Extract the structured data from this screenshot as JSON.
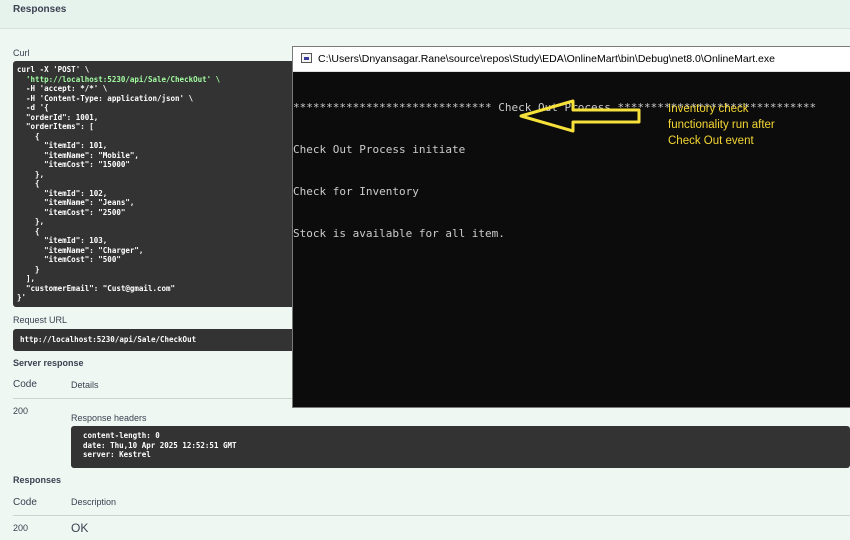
{
  "page": {
    "responses_title": "Responses",
    "curl_label": "Curl",
    "curl_lines": [
      [
        "curl -X 'POST' \\",
        ""
      ],
      [
        "  ",
        "'http://localhost:5230/api/Sale/CheckOut' \\"
      ],
      [
        "  -H 'accept: */*' \\",
        ""
      ],
      [
        "  -H 'Content-Type: application/json' \\",
        ""
      ],
      [
        "  -d '{",
        ""
      ],
      [
        "  \"orderId\": 1001,",
        ""
      ],
      [
        "  \"orderItems\": [",
        ""
      ],
      [
        "    {",
        ""
      ],
      [
        "      \"itemId\": 101,",
        ""
      ],
      [
        "      \"itemName\": \"Mobile\",",
        ""
      ],
      [
        "      \"itemCost\": \"15000\"",
        ""
      ],
      [
        "    },",
        ""
      ],
      [
        "    {",
        ""
      ],
      [
        "      \"itemId\": 102,",
        ""
      ],
      [
        "      \"itemName\": \"Jeans\",",
        ""
      ],
      [
        "      \"itemCost\": \"2500\"",
        ""
      ],
      [
        "    },",
        ""
      ],
      [
        "    {",
        ""
      ],
      [
        "      \"itemId\": 103,",
        ""
      ],
      [
        "      \"itemName\": \"Charger\",",
        ""
      ],
      [
        "      \"itemCost\": \"500\"",
        ""
      ],
      [
        "    }",
        ""
      ],
      [
        "  ],",
        ""
      ],
      [
        "  \"customerEmail\": \"Cust@gmail.com\"",
        ""
      ],
      [
        "}'",
        ""
      ]
    ],
    "request_url_label": "Request URL",
    "request_url": "http://localhost:5230/api/Sale/CheckOut",
    "server_response_label": "Server response",
    "code_header": "Code",
    "details_header": "Details",
    "status_code": "200",
    "response_headers_label": "Response headers",
    "response_headers": [
      "content-length: 0",
      "date: Thu,10 Apr 2025 12:52:51 GMT",
      "server: Kestrel"
    ],
    "responses_label": "Responses",
    "description_header": "Description",
    "response_code": "200",
    "response_description": "OK"
  },
  "console": {
    "title": "C:\\Users\\Dnyansagar.Rane\\source\\repos\\Study\\EDA\\OnlineMart\\bin\\Debug\\net8.0\\OnlineMart.exe",
    "lines": [
      "****************************** Check Out Process ******************************",
      "Check Out Process initiate",
      "Check for Inventory",
      "Stock is available for all item."
    ],
    "annotation_lines": [
      "Inventory check",
      "functionality run after",
      "Check Out event"
    ],
    "annotation_color": "#f5d733"
  }
}
